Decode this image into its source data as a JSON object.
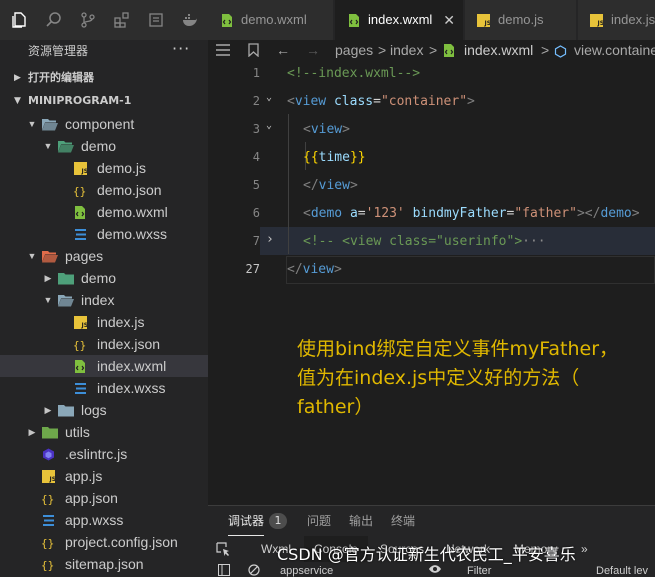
{
  "explorer": {
    "title": "资源管理器",
    "more": "···",
    "open_editors_label": "打开的编辑器",
    "project_label": "MINIPROGRAM-1"
  },
  "tree": [
    {
      "label": "component",
      "type": "folder",
      "open": true
    },
    {
      "label": "demo",
      "type": "folder",
      "open": true
    },
    {
      "label": "demo.js",
      "type": "js"
    },
    {
      "label": "demo.json",
      "type": "json"
    },
    {
      "label": "demo.wxml",
      "type": "wxml"
    },
    {
      "label": "demo.wxss",
      "type": "wxss"
    },
    {
      "label": "pages",
      "type": "folder",
      "open": true
    },
    {
      "label": "demo",
      "type": "folder",
      "open": false
    },
    {
      "label": "index",
      "type": "folder",
      "open": true
    },
    {
      "label": "index.js",
      "type": "js"
    },
    {
      "label": "index.json",
      "type": "json"
    },
    {
      "label": "index.wxml",
      "type": "wxml",
      "selected": true
    },
    {
      "label": "index.wxss",
      "type": "wxss"
    },
    {
      "label": "logs",
      "type": "folder",
      "open": false
    },
    {
      "label": "utils",
      "type": "folder",
      "open": false
    },
    {
      "label": ".eslintrc.js",
      "type": "eslint"
    },
    {
      "label": "app.js",
      "type": "js"
    },
    {
      "label": "app.json",
      "type": "json"
    },
    {
      "label": "app.wxss",
      "type": "wxss"
    },
    {
      "label": "project.config.json",
      "type": "json"
    },
    {
      "label": "sitemap.json",
      "type": "json"
    }
  ],
  "tabs": [
    {
      "label": "demo.wxml",
      "type": "wxml"
    },
    {
      "label": "index.wxml",
      "type": "wxml",
      "active": true,
      "close": "✕"
    },
    {
      "label": "demo.js",
      "type": "js"
    },
    {
      "label": "index.js",
      "type": "js"
    }
  ],
  "breadcrumb": {
    "pages": "pages",
    "sep1": ">",
    "index": "index",
    "sep2": ">",
    "file": "index.wxml",
    "sep3": ">",
    "node": "view.container"
  },
  "code": {
    "line_numbers": [
      "1",
      "2",
      "3",
      "4",
      "5",
      "6",
      "7",
      "27"
    ],
    "l1_comment": "<!--index.wxml-->",
    "l2_open": "<",
    "l2_tag": "view",
    "l2_attr": " class",
    "l2_eq": "=",
    "l2_val": "\"container\"",
    "l2_close": ">",
    "l3_open": "<",
    "l3_tag": "view",
    "l3_close": ">",
    "l4_open": "{{",
    "l4_var": "time",
    "l4_close": "}}",
    "l5_open": "</",
    "l5_tag": "view",
    "l5_close": ">",
    "l6_open": "<",
    "l6_tag": "demo",
    "l6_attr1": " a",
    "l6_eq1": "=",
    "l6_val1": "'123'",
    "l6_attr2": " bindmyFather",
    "l6_eq2": "=",
    "l6_val2": "\"father\"",
    "l6_mid": "></",
    "l6_tag2": "demo",
    "l6_close": ">",
    "l7_comment": "<!-- <view class=\"userinfo\">",
    "l7_ellipsis": "···",
    "l27_open": "</",
    "l27_tag": "view",
    "l27_close": ">"
  },
  "annotation": {
    "line1": "使用bind绑定自定义事件myFather，",
    "line2": "值为在index.js中定义好的方法（",
    "line3": "father）"
  },
  "panel": {
    "debugger": "调试器",
    "badge": "1",
    "problems": "问题",
    "output": "输出",
    "terminal": "终端",
    "subtabs": [
      "Wxml",
      "Console",
      "Sources",
      "Network",
      "Memory",
      "»"
    ],
    "context": "appservice",
    "filter": "Filter",
    "levels": "Default lev"
  },
  "watermark": "CSDN @官方认证新生代农民工_平安喜乐",
  "colors": {
    "js": "#e8c33a",
    "json": "#e8c33a",
    "wxml": "#7fbf3f",
    "wxss": "#3d8fd9",
    "folder": "#89a0b0",
    "annotation": "#e0b800"
  }
}
